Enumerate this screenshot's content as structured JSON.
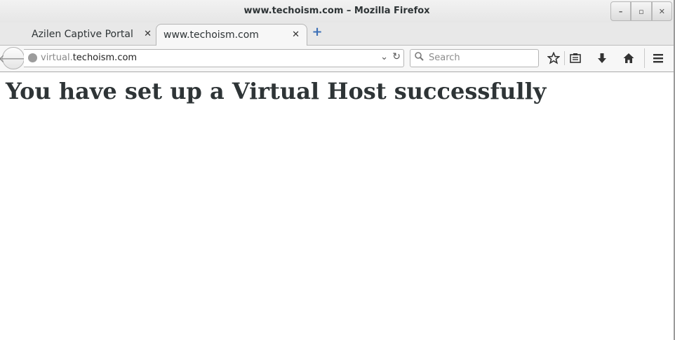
{
  "window": {
    "title": "www.techoism.com – Mozilla Firefox",
    "controls": {
      "minimize": "–",
      "maximize": "▫",
      "close": "✕"
    }
  },
  "tabs": [
    {
      "label": "Azilen Captive Portal",
      "active": false
    },
    {
      "label": "www.techoism.com",
      "active": true
    }
  ],
  "tab_close_glyph": "✕",
  "new_tab_glyph": "+",
  "navbar": {
    "back_glyph": "🡐",
    "url_subdomain": "virtual.",
    "url_domain": "techoism.com",
    "dropdown_glyph": "⌄",
    "reload_glyph": "↻",
    "search_placeholder": "Search",
    "search_icon": "search-icon",
    "toolbar_icons": [
      "star-icon",
      "reading-list-icon",
      "download-icon",
      "home-icon",
      "menu-icon"
    ]
  },
  "page": {
    "heading": "You have set up a Virtual Host successfully"
  }
}
